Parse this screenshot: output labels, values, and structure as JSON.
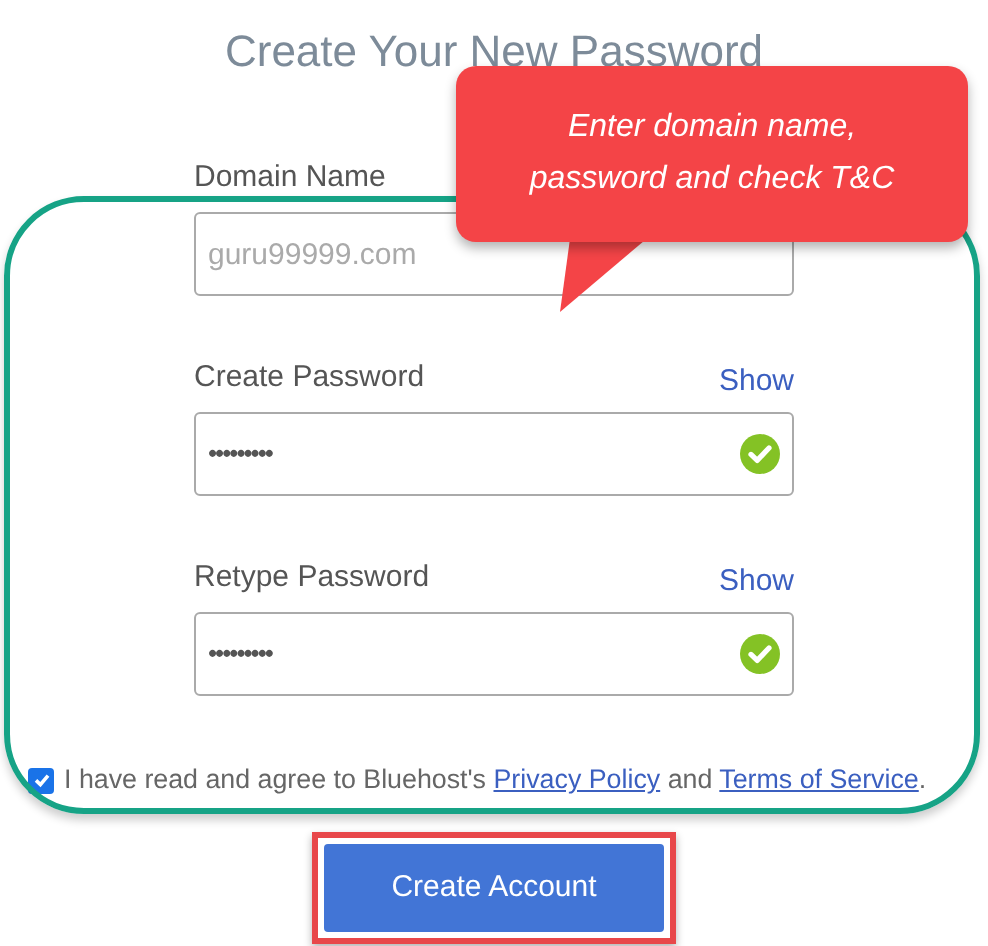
{
  "title": "Create Your New Password",
  "fields": [
    {
      "label": "Domain Name",
      "placeholder": "guru99999.com"
    },
    {
      "label": "Create Password",
      "show": "Show",
      "value": "•••••••••",
      "valid": true
    },
    {
      "label": "Retype Password",
      "show": "Show",
      "value": "•••••••••",
      "valid": true
    }
  ],
  "agreement": {
    "checked": true,
    "text": "I have read and agree to Bluehost's",
    "privacy": "Privacy Policy",
    "and": "and",
    "terms": "Terms of Service",
    "end": "."
  },
  "button": "Create Account",
  "callout": {
    "lines": [
      "Enter domain name,",
      "password and check T&C"
    ]
  }
}
